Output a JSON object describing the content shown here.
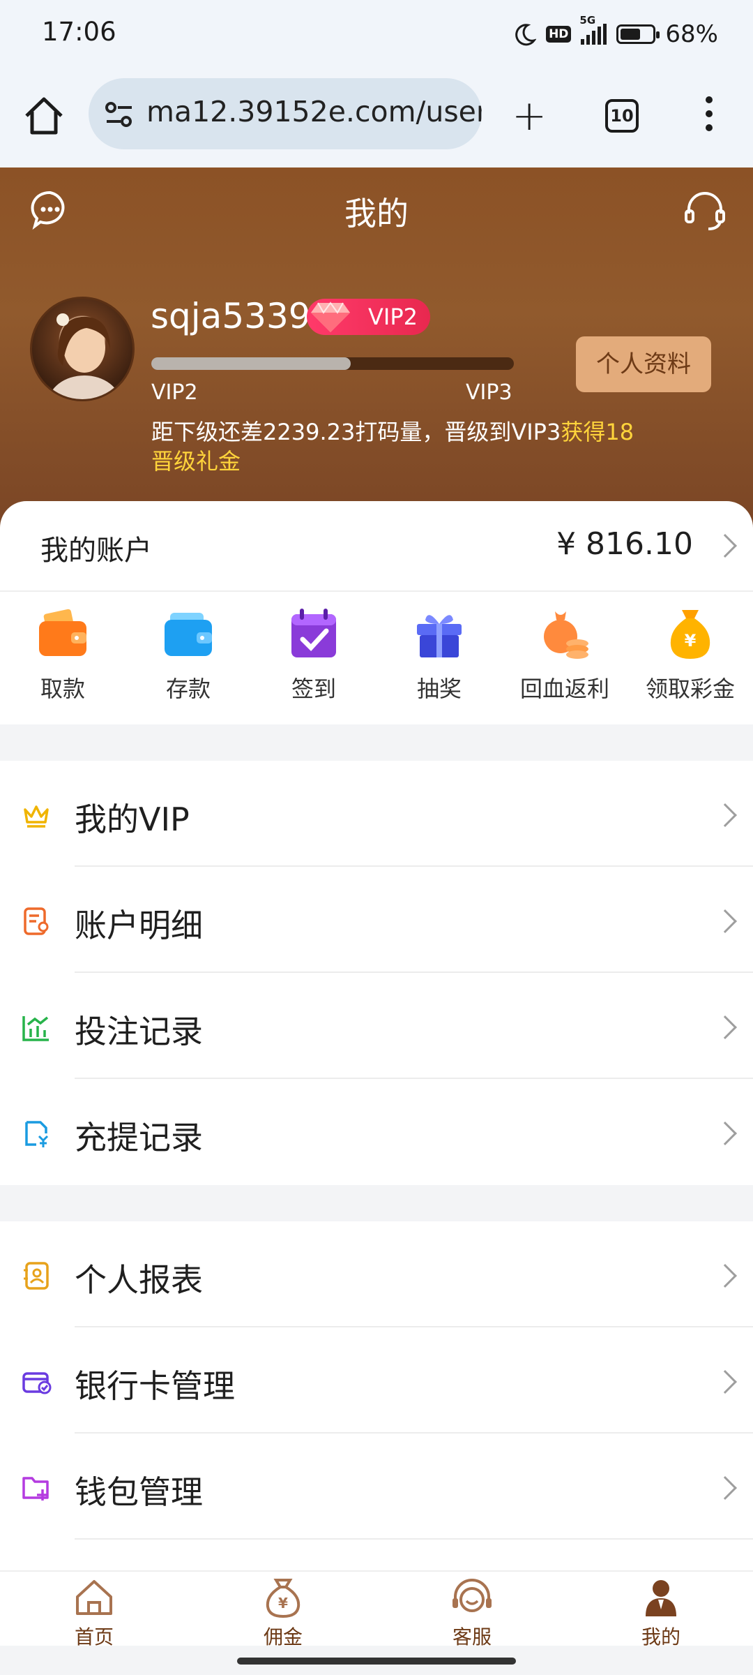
{
  "status_bar": {
    "time": "17:06",
    "hd": "HD",
    "network": "5G",
    "battery": "68%",
    "battery_level": 0.68
  },
  "browser": {
    "url": "ma12.39152e.com/user",
    "tab_count": "10"
  },
  "header": {
    "title": "我的",
    "username": "sqja5339",
    "vip_badge": "VIP2",
    "level_from": "VIP2",
    "level_to": "VIP3",
    "progress_fraction": 0.55,
    "profile_button": "个人资料",
    "upgrade_text": "距下级还差2239.23打码量，晋级到VIP3",
    "upgrade_highlight": "获得18晋级礼金"
  },
  "account": {
    "label": "我的账户",
    "balance": "¥ 816.10"
  },
  "quick_actions": [
    {
      "label": "取款",
      "icon": "withdraw-wallet-icon"
    },
    {
      "label": "存款",
      "icon": "deposit-wallet-icon"
    },
    {
      "label": "签到",
      "icon": "checkin-calendar-icon"
    },
    {
      "label": "抽奖",
      "icon": "lottery-gift-icon"
    },
    {
      "label": "回血返利",
      "icon": "rebate-coins-icon"
    },
    {
      "label": "领取彩金",
      "icon": "bonus-moneybag-icon"
    }
  ],
  "menu_group_1": [
    {
      "label": "我的VIP",
      "icon": "crown-icon",
      "color": "#f0b400"
    },
    {
      "label": "账户明细",
      "icon": "account-detail-icon",
      "color": "#ee6a2b"
    },
    {
      "label": "投注记录",
      "icon": "bet-chart-icon",
      "color": "#27b34a"
    },
    {
      "label": "充提记录",
      "icon": "recharge-record-icon",
      "color": "#1a9be0"
    }
  ],
  "menu_group_2": [
    {
      "label": "个人报表",
      "icon": "personal-report-icon",
      "color": "#e7a21b"
    },
    {
      "label": "银行卡管理",
      "icon": "bank-card-icon",
      "color": "#6a3be0"
    },
    {
      "label": "钱包管理",
      "icon": "wallet-folder-icon",
      "color": "#b43be0"
    }
  ],
  "bottom_nav": [
    {
      "label": "首页",
      "icon": "home-icon"
    },
    {
      "label": "佣金",
      "icon": "commission-bag-icon"
    },
    {
      "label": "客服",
      "icon": "customer-service-icon"
    },
    {
      "label": "我的",
      "icon": "profile-icon"
    }
  ],
  "colors": {
    "header_brown": "#8c5226",
    "accent_gold": "#ffd43b",
    "nav_brown": "#6d3a16",
    "vip_red": "#e8284f"
  }
}
